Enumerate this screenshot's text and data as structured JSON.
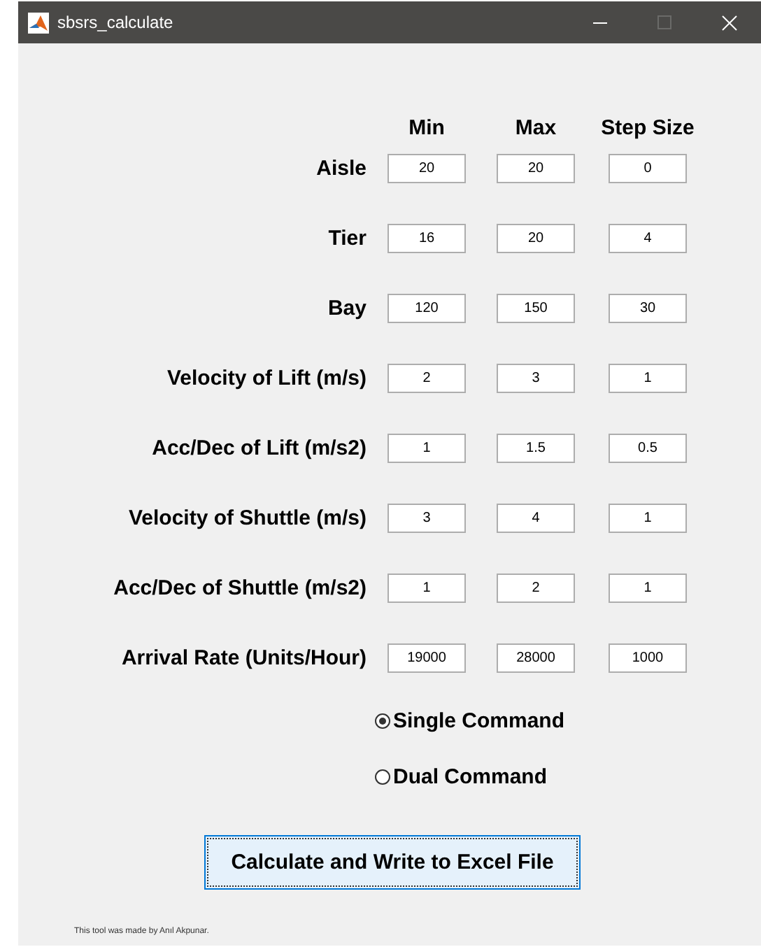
{
  "window": {
    "title": "sbsrs_calculate"
  },
  "columns": [
    "Min",
    "Max",
    "Step Size"
  ],
  "parameters": [
    {
      "label": "Aisle",
      "values": [
        "20",
        "20",
        "0"
      ]
    },
    {
      "label": "Tier",
      "values": [
        "16",
        "20",
        "4"
      ]
    },
    {
      "label": "Bay",
      "values": [
        "120",
        "150",
        "30"
      ]
    },
    {
      "label": "Velocity of Lift (m/s)",
      "values": [
        "2",
        "3",
        "1"
      ]
    },
    {
      "label": "Acc/Dec of Lift (m/s2)",
      "values": [
        "1",
        "1.5",
        "0.5"
      ]
    },
    {
      "label": "Velocity of Shuttle (m/s)",
      "values": [
        "3",
        "4",
        "1"
      ]
    },
    {
      "label": "Acc/Dec of Shuttle (m/s2)",
      "values": [
        "1",
        "2",
        "1"
      ]
    },
    {
      "label": "Arrival Rate (Units/Hour)",
      "values": [
        "19000",
        "28000",
        "1000"
      ]
    }
  ],
  "command_mode": [
    {
      "label": "Single Command",
      "selected": true
    },
    {
      "label": "Dual Command",
      "selected": false
    }
  ],
  "calculate_button": {
    "label": "Calculate and Write to Excel File"
  },
  "footer": "This tool was made by Anıl Akpunar."
}
